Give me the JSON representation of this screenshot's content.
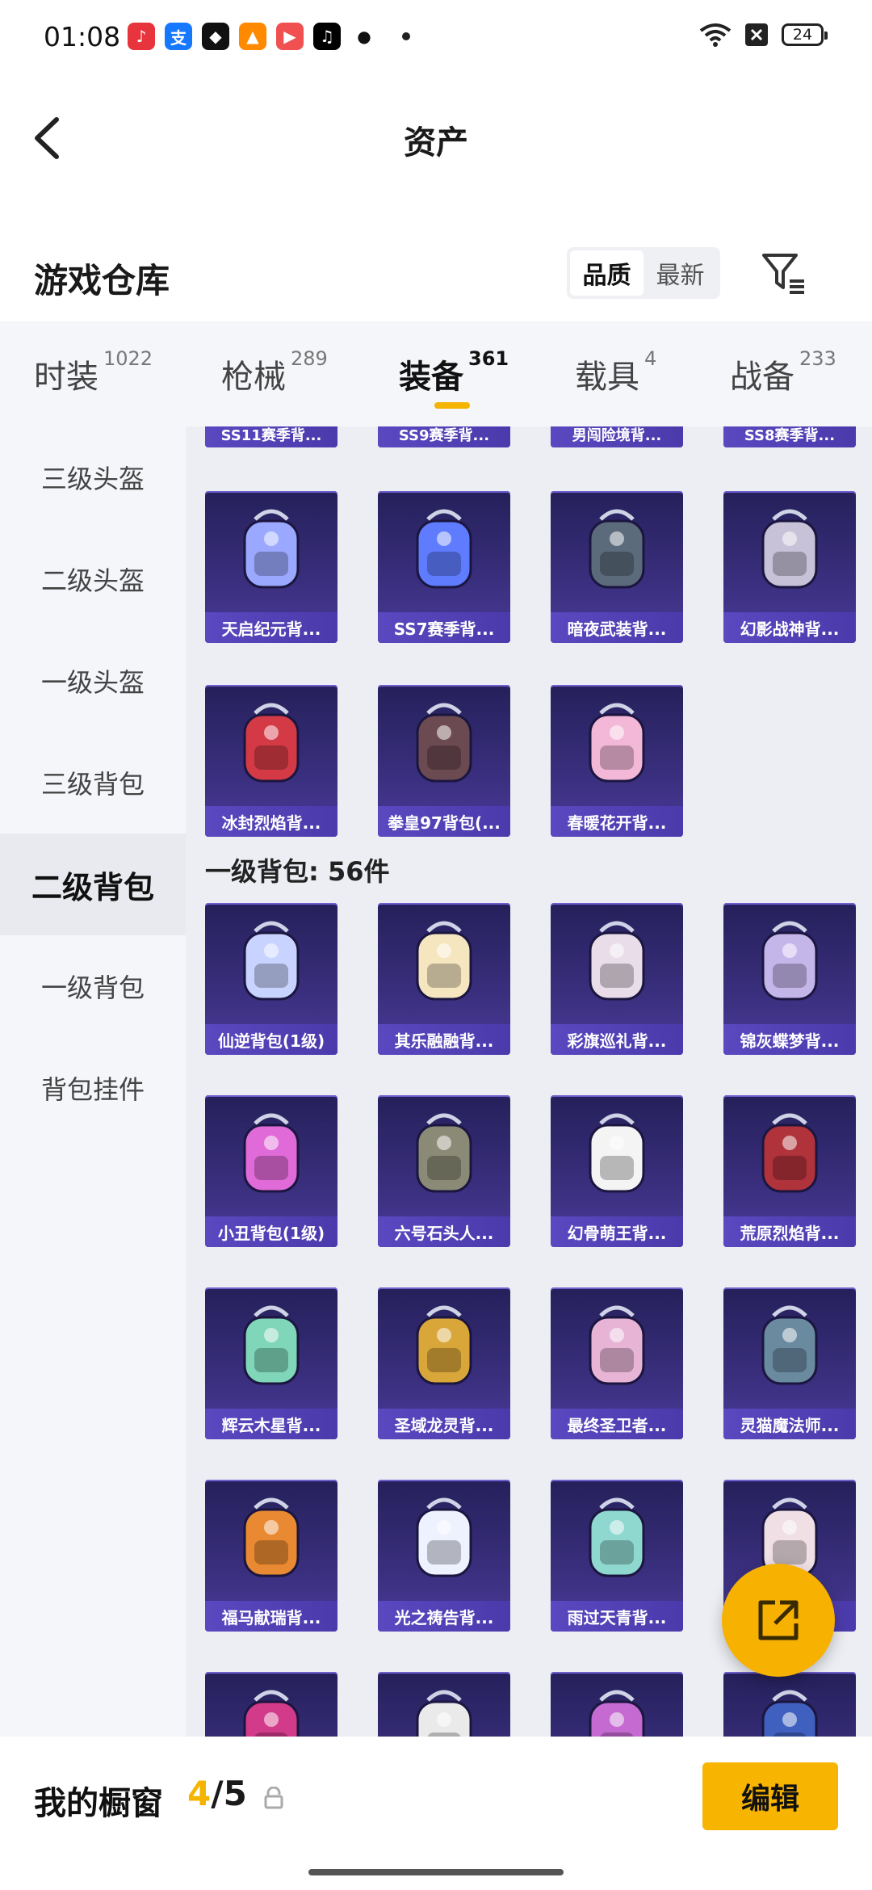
{
  "status_bar": {
    "time": "01:08",
    "battery": "24"
  },
  "nav": {
    "title": "资产"
  },
  "warehouse": {
    "title": "游戏仓库",
    "sort_options": [
      "品质",
      "最新"
    ],
    "active_sort": "品质"
  },
  "tabs": [
    {
      "label": "时装",
      "count": "1022"
    },
    {
      "label": "枪械",
      "count": "289"
    },
    {
      "label": "装备",
      "count": "361"
    },
    {
      "label": "载具",
      "count": "4"
    },
    {
      "label": "战备",
      "count": "233"
    }
  ],
  "active_tab": "装备",
  "sidebar": [
    {
      "label": "三级头盔"
    },
    {
      "label": "二级头盔"
    },
    {
      "label": "一级头盔"
    },
    {
      "label": "三级背包"
    },
    {
      "label": "二级背包"
    },
    {
      "label": "一级背包"
    },
    {
      "label": "背包挂件"
    }
  ],
  "active_sidebar": "二级背包",
  "partial_row": [
    "SS11赛季背...",
    "SS9赛季背...",
    "男闯险境背...",
    "SS8赛季背..."
  ],
  "level2_items": [
    {
      "name": "天启纪元背...",
      "icon": "backpack-icon",
      "color": "#9aa8ff"
    },
    {
      "name": "SS7赛季背...",
      "icon": "backpack-icon",
      "color": "#5f7cff"
    },
    {
      "name": "暗夜武装背...",
      "icon": "backpack-icon",
      "color": "#5c6b7c"
    },
    {
      "name": "幻影战神背...",
      "icon": "backpack-icon",
      "color": "#c7c2d8"
    },
    {
      "name": "冰封烈焰背...",
      "icon": "backpack-icon",
      "color": "#d43a45"
    },
    {
      "name": "拳皇97背包(...",
      "icon": "backpack-icon",
      "color": "#6c4a52"
    },
    {
      "name": "春暖花开背...",
      "icon": "backpack-icon",
      "color": "#f3b8d8"
    }
  ],
  "level1_section": {
    "title": "一级背包: 56件"
  },
  "level1_items": [
    {
      "name": "仙逆背包(1级)",
      "color": "#c9d3ff"
    },
    {
      "name": "其乐融融背...",
      "color": "#f5e6c0"
    },
    {
      "name": "彩旗巡礼背...",
      "color": "#e9dde9"
    },
    {
      "name": "锦灰蝶梦背...",
      "color": "#c5b6ea"
    },
    {
      "name": "小丑背包(1级)",
      "color": "#e06ad8"
    },
    {
      "name": "六号石头人...",
      "color": "#8a8a76"
    },
    {
      "name": "幻骨萌王背...",
      "color": "#f4f4f4"
    },
    {
      "name": "荒原烈焰背...",
      "color": "#b0323a"
    },
    {
      "name": "辉云木星背...",
      "color": "#7fd6b8"
    },
    {
      "name": "圣域龙灵背...",
      "color": "#d9a63a"
    },
    {
      "name": "最终圣卫者...",
      "color": "#e7b4d6"
    },
    {
      "name": "灵猫魔法师...",
      "color": "#6a8aa0"
    },
    {
      "name": "福马献瑞背...",
      "color": "#e98a32"
    },
    {
      "name": "光之祷告背...",
      "color": "#eef2ff"
    },
    {
      "name": "雨过天青背...",
      "color": "#8fd8d0"
    },
    {
      "name": "",
      "color": "#f0e0e6"
    },
    {
      "name": "",
      "color": "#d23a8a"
    },
    {
      "name": "",
      "color": "#eaeaea"
    },
    {
      "name": "",
      "color": "#c46ad0"
    },
    {
      "name": "",
      "color": "#4060c0"
    }
  ],
  "bottom": {
    "label": "我的橱窗",
    "current": "4",
    "sep": "/",
    "total": "5",
    "edit_label": "编辑"
  }
}
